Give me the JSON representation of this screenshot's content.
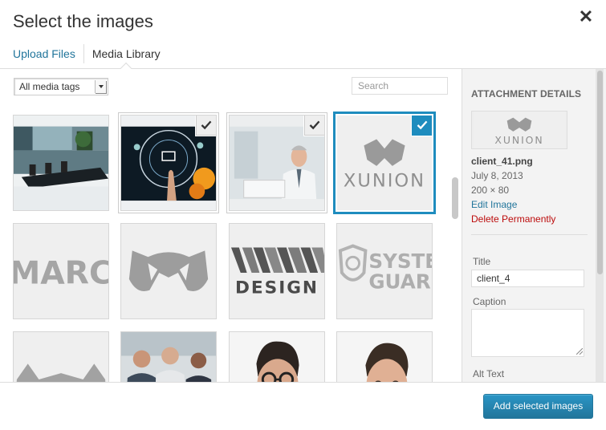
{
  "header": {
    "title": "Select the images",
    "close_icon": "close-icon"
  },
  "tabs": [
    {
      "label": "Upload Files",
      "active": false
    },
    {
      "label": "Media Library",
      "active": true
    }
  ],
  "toolbar": {
    "filter_selected": "All media tags",
    "search_placeholder": "Search"
  },
  "thumbnails": [
    {
      "subject": "conference room photo",
      "selected": false
    },
    {
      "subject": "touchscreen technology photo",
      "selected": true
    },
    {
      "subject": "businessman at laptop photo",
      "selected": true
    },
    {
      "subject": "xunion logo",
      "selected": true,
      "details_open": true,
      "text": "XUNION"
    },
    {
      "subject": "marcs logo",
      "selected": false,
      "text": "MARCS"
    },
    {
      "subject": "cat mask logo",
      "selected": false
    },
    {
      "subject": "design logo",
      "selected": false,
      "text": "DESIGN"
    },
    {
      "subject": "system guard logo",
      "selected": false,
      "text": [
        "SYSTE",
        "GUAR"
      ]
    },
    {
      "subject": "logo partial",
      "selected": false
    },
    {
      "subject": "group meeting photo",
      "selected": false
    },
    {
      "subject": "man with glasses portrait",
      "selected": false
    },
    {
      "subject": "man portrait",
      "selected": false
    }
  ],
  "sidebar": {
    "heading": "Attachment Details",
    "preview_text": "XUNION",
    "filename": "client_41.png",
    "date": "July 8, 2013",
    "dimensions": "200 × 80",
    "edit_link": "Edit Image",
    "delete_link": "Delete Permanently",
    "title_label": "Title",
    "title_value": "client_4",
    "caption_label": "Caption",
    "caption_value": "",
    "alt_label": "Alt Text"
  },
  "footer": {
    "primary_button": "Add selected images"
  },
  "colors": {
    "accent": "#21759b",
    "selection": "#1e8cbe",
    "delete": "#bc0b0b"
  }
}
